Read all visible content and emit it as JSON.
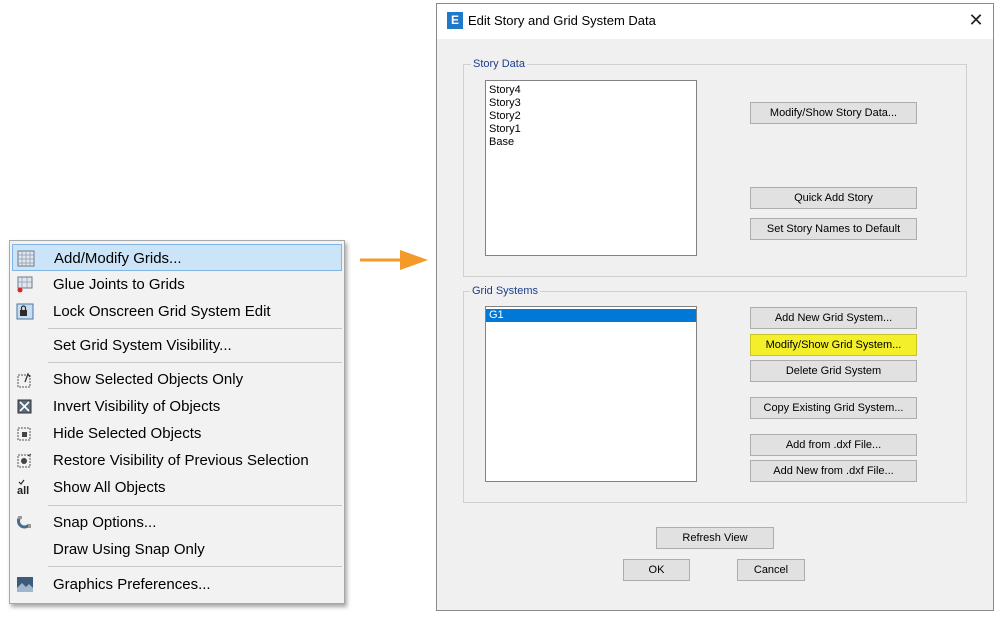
{
  "menu": {
    "items": [
      {
        "label": "Add/Modify Grids...",
        "icon": "grid-icon"
      },
      {
        "label": "Glue Joints to Grids",
        "icon": "glue-joints-icon"
      },
      {
        "label": "Lock Onscreen Grid System Edit",
        "icon": "lock-grid-icon"
      },
      {
        "label": "Set Grid System Visibility..."
      },
      {
        "label": "Show Selected Objects Only",
        "icon": "show-selected-icon"
      },
      {
        "label": "Invert Visibility of Objects",
        "icon": "invert-visibility-icon"
      },
      {
        "label": "Hide Selected Objects",
        "icon": "hide-selected-icon"
      },
      {
        "label": "Restore Visibility of Previous Selection",
        "icon": "restore-visibility-icon"
      },
      {
        "label": "Show All Objects",
        "icon": "show-all-icon"
      },
      {
        "label": "Snap Options...",
        "icon": "snap-icon"
      },
      {
        "label": "Draw Using Snap Only"
      },
      {
        "label": "Graphics Preferences...",
        "icon": "graphics-preferences-icon"
      }
    ]
  },
  "dialog": {
    "app_icon": "E",
    "title": "Edit Story and Grid System Data",
    "close": "✕",
    "story_data": {
      "label": "Story Data",
      "stories": [
        "Story4",
        "Story3",
        "Story2",
        "Story1",
        "Base"
      ],
      "buttons": {
        "modify_show": "Modify/Show Story Data...",
        "quick_add": "Quick Add Story",
        "set_default": "Set Story Names to Default"
      }
    },
    "grid_systems": {
      "label": "Grid Systems",
      "grids": [
        "G1"
      ],
      "buttons": {
        "add_new": "Add New Grid System...",
        "modify_show": "Modify/Show Grid System...",
        "delete": "Delete Grid System",
        "copy": "Copy Existing Grid System...",
        "add_dxf": "Add  from .dxf File...",
        "add_new_dxf": "Add New from .dxf File..."
      }
    },
    "refresh": "Refresh View",
    "ok": "OK",
    "cancel": "Cancel"
  },
  "colors": {
    "accent_arrow": "#f39a2b",
    "selection": "#0078d7",
    "highlight": "#f3ef2a",
    "menu_active": "#cce4f7"
  }
}
